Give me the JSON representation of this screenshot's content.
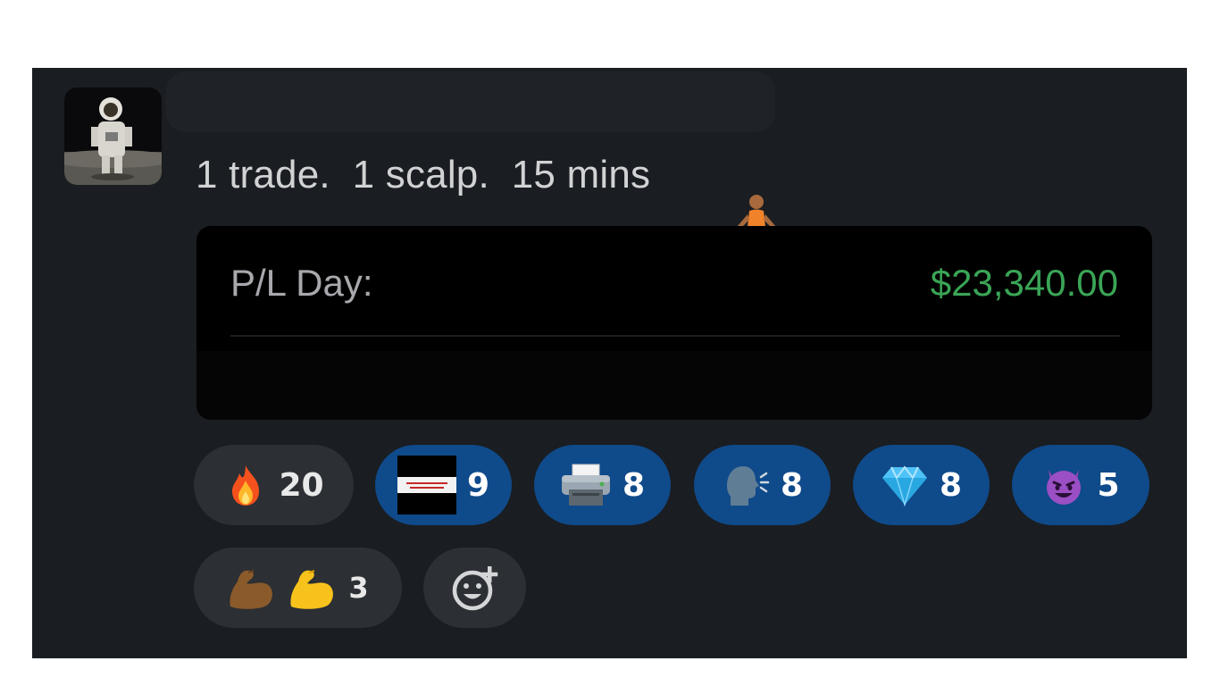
{
  "message": {
    "text": "1 trade.  1 scalp.  15 mins",
    "text_emoji": "person-in-lotus-position-icon"
  },
  "card": {
    "label": "P/L Day:",
    "value": "$23,340.00",
    "value_color": "#3aa556"
  },
  "reactions": [
    {
      "icon": "fire-icon",
      "count": "20",
      "style": "grey"
    },
    {
      "icon": "money-printer-custom-emoji-icon",
      "count": "9",
      "style": "blue",
      "emoji_lettering": "THE MONEY PRINTER"
    },
    {
      "icon": "printer-icon",
      "count": "8",
      "style": "blue"
    },
    {
      "icon": "speaking-head-icon",
      "count": "8",
      "style": "blue"
    },
    {
      "icon": "gem-stone-icon",
      "count": "8",
      "style": "blue"
    },
    {
      "icon": "smiling-imp-icon",
      "count": "5",
      "style": "blue"
    },
    {
      "icon": "flexed-biceps-pair-icon",
      "count": "3",
      "style": "grey"
    }
  ],
  "add_reaction": {
    "icon": "add-reaction-icon"
  },
  "colors": {
    "panel_bg": "#1a1d21",
    "reacted_pill": "#0f4a8a",
    "pill": "#2c2f33"
  }
}
